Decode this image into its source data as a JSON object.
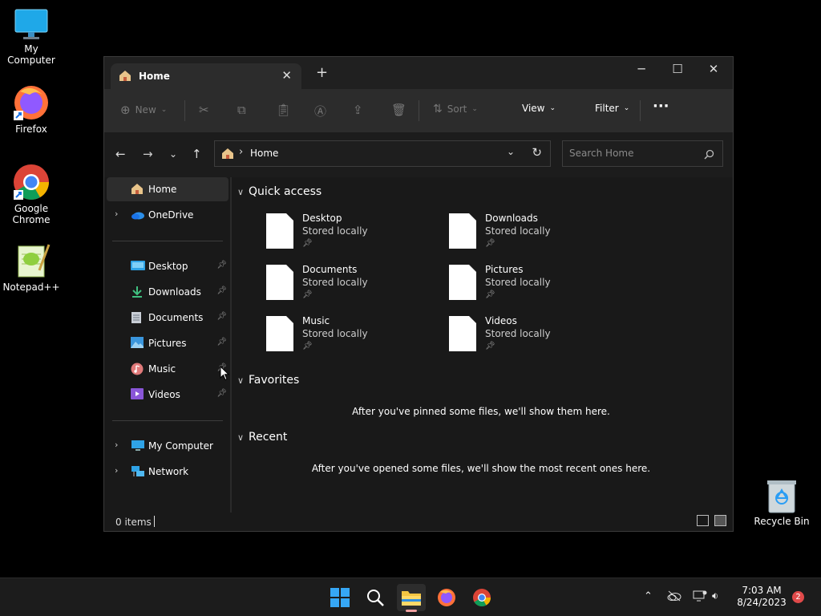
{
  "desktop": {
    "icons": [
      {
        "label": "My Computer"
      },
      {
        "label": "Firefox"
      },
      {
        "label": "Google Chrome"
      },
      {
        "label": "Notepad++"
      },
      {
        "label": "Recycle Bin"
      }
    ]
  },
  "window": {
    "tab_title": "Home",
    "toolbar": {
      "new_label": "New",
      "sort_label": "Sort",
      "view_label": "View",
      "filter_label": "Filter",
      "more_label": "···"
    },
    "address": {
      "crumb": "Home",
      "search_placeholder": "Search Home"
    },
    "sidebar": {
      "items": [
        {
          "label": "Home"
        },
        {
          "label": "OneDrive"
        },
        {
          "label": "Desktop"
        },
        {
          "label": "Downloads"
        },
        {
          "label": "Documents"
        },
        {
          "label": "Pictures"
        },
        {
          "label": "Music"
        },
        {
          "label": "Videos"
        },
        {
          "label": "My Computer"
        },
        {
          "label": "Network"
        }
      ]
    },
    "sections": {
      "quick_access": "Quick access",
      "favorites": "Favorites",
      "recent": "Recent",
      "favorites_empty": "After you've pinned some files, we'll show them here.",
      "recent_empty": "After you've opened some files, we'll show the most recent ones here."
    },
    "quick_access": [
      {
        "name": "Desktop",
        "sub": "Stored locally"
      },
      {
        "name": "Downloads",
        "sub": "Stored locally"
      },
      {
        "name": "Documents",
        "sub": "Stored locally"
      },
      {
        "name": "Pictures",
        "sub": "Stored locally"
      },
      {
        "name": "Music",
        "sub": "Stored locally"
      },
      {
        "name": "Videos",
        "sub": "Stored locally"
      }
    ],
    "status": {
      "items": "0 items"
    }
  },
  "taskbar": {
    "time": "7:03 AM",
    "date": "8/24/2023",
    "notifications": "2"
  },
  "colors": {
    "window_bg": "#191919",
    "toolbar_bg": "#2c2c2c",
    "folder_yellow": "#f4c542",
    "accent_blue": "#0a84ff"
  }
}
